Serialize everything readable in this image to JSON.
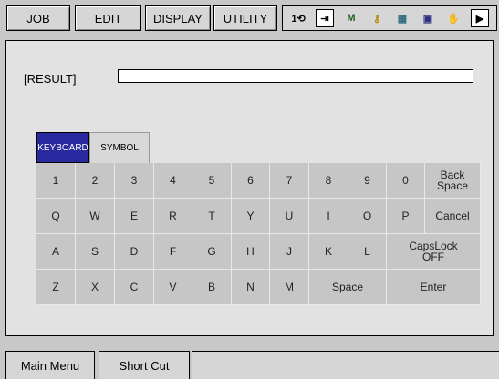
{
  "menu": {
    "job": "JOB",
    "edit": "EDIT",
    "display": "DISPLAY",
    "utility": "UTILITY"
  },
  "status_icons": [
    {
      "name": "cycle-icon",
      "glyph": "1⟲"
    },
    {
      "name": "mode-icon",
      "glyph": "⇥"
    },
    {
      "name": "manual-speed-icon",
      "glyph": "M"
    },
    {
      "name": "security-key-icon",
      "glyph": "⚷"
    },
    {
      "name": "tool-icon",
      "glyph": "▦"
    },
    {
      "name": "program-icon",
      "glyph": "▣"
    },
    {
      "name": "hand-icon",
      "glyph": "✋"
    },
    {
      "name": "play-icon",
      "glyph": "▶"
    }
  ],
  "result": {
    "label": "[RESULT]",
    "value": ""
  },
  "tabs": {
    "keyboard": "KEYBOARD",
    "symbol": "SYMBOL"
  },
  "keyboard": {
    "row1": [
      "1",
      "2",
      "3",
      "4",
      "5",
      "6",
      "7",
      "8",
      "9",
      "0"
    ],
    "backspace": "Back Space",
    "row2": [
      "Q",
      "W",
      "E",
      "R",
      "T",
      "Y",
      "U",
      "I",
      "O",
      "P"
    ],
    "cancel": "Cancel",
    "row3": [
      "A",
      "S",
      "D",
      "F",
      "G",
      "H",
      "J",
      "K",
      "L"
    ],
    "capslock": "CapsLock OFF",
    "row4": [
      "Z",
      "X",
      "C",
      "V",
      "B",
      "N",
      "M"
    ],
    "space": "Space",
    "enter": "Enter"
  },
  "bottom": {
    "main_menu": "Main Menu",
    "short_cut": "Short Cut"
  },
  "colors": {
    "active_tab": "#2a2aa0",
    "key_face": "#c6c6c6",
    "panel": "#e2e2e2"
  }
}
